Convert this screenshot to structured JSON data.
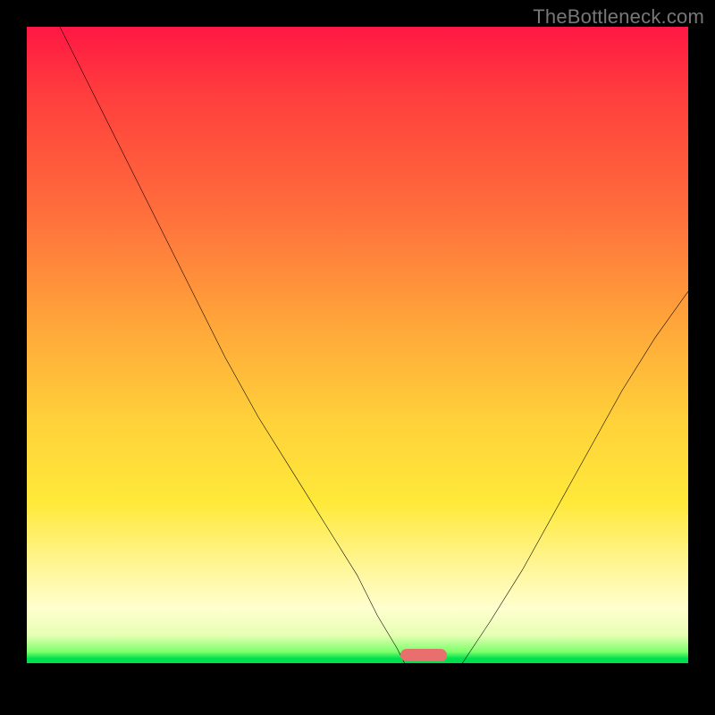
{
  "watermark": {
    "text": "TheBottleneck.com"
  },
  "chart_data": {
    "type": "line",
    "title": "",
    "xlabel": "",
    "ylabel": "",
    "xlim": [
      0,
      100
    ],
    "ylim": [
      0,
      100
    ],
    "grid": false,
    "legend": false,
    "gradient_stops": [
      {
        "pos": 0,
        "color": "#ff1744"
      },
      {
        "pos": 10,
        "color": "#ff3d3d"
      },
      {
        "pos": 28,
        "color": "#ff6e3c"
      },
      {
        "pos": 45,
        "color": "#ffa63a"
      },
      {
        "pos": 60,
        "color": "#ffd23a"
      },
      {
        "pos": 72,
        "color": "#ffe93a"
      },
      {
        "pos": 82,
        "color": "#fff69a"
      },
      {
        "pos": 88,
        "color": "#ffffcf"
      },
      {
        "pos": 92,
        "color": "#e6ffb3"
      },
      {
        "pos": 94.5,
        "color": "#7dff6b"
      },
      {
        "pos": 95.5,
        "color": "#00e04e"
      },
      {
        "pos": 96.2,
        "color": "#00e04e"
      },
      {
        "pos": 96.2,
        "color": "#000000"
      },
      {
        "pos": 100,
        "color": "#000000"
      }
    ],
    "series": [
      {
        "name": "left-curve",
        "x": [
          5,
          10,
          15,
          20,
          25,
          30,
          35,
          40,
          45,
          50,
          53,
          56,
          58,
          59
        ],
        "values": [
          100,
          90,
          80,
          70,
          60,
          50,
          41,
          33,
          25,
          17,
          11,
          6,
          2,
          0
        ]
      },
      {
        "name": "right-curve",
        "x": [
          63,
          66,
          70,
          75,
          80,
          85,
          90,
          95,
          100
        ],
        "values": [
          0,
          4,
          10,
          18,
          27,
          36,
          45,
          53,
          60
        ]
      }
    ],
    "marker": {
      "name": "bottleneck-range",
      "x_center": 60,
      "width": 6,
      "y": 4,
      "color": "#e96f6f"
    }
  }
}
